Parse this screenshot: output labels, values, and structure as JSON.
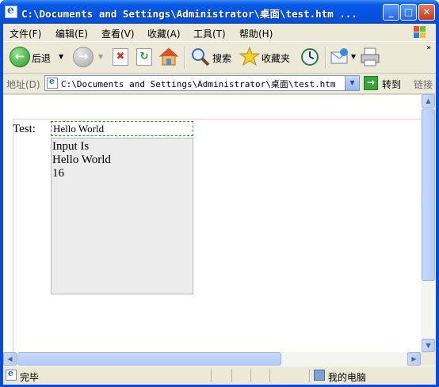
{
  "window": {
    "title": "C:\\Documents and Settings\\Administrator\\桌面\\test.htm ..."
  },
  "menubar": {
    "items": [
      "文件(F)",
      "编辑(E)",
      "查看(V)",
      "收藏(A)",
      "工具(T)",
      "帮助(H)"
    ]
  },
  "toolbar": {
    "back_label": "后退",
    "search_label": "搜索",
    "favorites_label": "收藏夹"
  },
  "addressbar": {
    "label": "地址(D)",
    "url": "C:\\Documents and Settings\\Administrator\\桌面\\test.htm",
    "go_label": "转到",
    "links_label": "链接"
  },
  "page": {
    "test_label": "Test:",
    "input_value": "Hello World",
    "output_lines": [
      "Input Is",
      "Hello World",
      "16"
    ]
  },
  "statusbar": {
    "status_text": "完毕",
    "zone_text": "我的电脑"
  },
  "colors": {
    "titlebar_blue": "#0554e2",
    "chrome_beige": "#ece9d8",
    "focus_dash_green": "#1a9a2a",
    "output_bg": "#ececec"
  },
  "icons": [
    "ie-page-icon",
    "minimize-icon",
    "maximize-icon",
    "close-icon",
    "windows-flag-icon",
    "back-arrow-icon",
    "forward-arrow-icon",
    "stop-icon",
    "refresh-icon",
    "home-icon",
    "search-icon",
    "favorites-star-icon",
    "history-icon",
    "mail-icon",
    "print-icon",
    "go-arrow-icon",
    "my-computer-icon"
  ]
}
